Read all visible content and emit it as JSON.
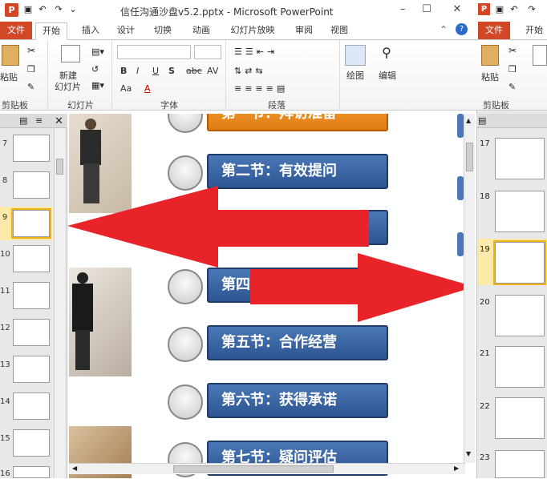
{
  "window": {
    "title": "信任沟通沙盘v5.2.pptx - Microsoft PowerPoint",
    "app_icon": "P"
  },
  "tabs": {
    "file": "文件",
    "items": [
      "开始",
      "插入",
      "设计",
      "切换",
      "动画",
      "幻灯片放映",
      "审阅",
      "视图"
    ]
  },
  "ribbon": {
    "clipboard": {
      "paste": "粘贴",
      "group": "剪贴板"
    },
    "slides": {
      "new_slide_1": "新建",
      "new_slide_2": "幻灯片",
      "group": "幻灯片"
    },
    "font": {
      "group": "字体",
      "buttons": [
        "B",
        "I",
        "U",
        "S",
        "abc",
        "AV",
        "Aa",
        "A"
      ]
    },
    "paragraph": {
      "group": "段落"
    },
    "drawing": {
      "label": "绘图"
    },
    "editing": {
      "label": "编辑"
    }
  },
  "thumbs_left": [
    "7",
    "8",
    "9",
    "10",
    "11",
    "12",
    "13",
    "14",
    "15",
    "16"
  ],
  "slide": {
    "sections": [
      "第一节：拜访准备",
      "第二节：有效提问",
      "",
      "第四",
      "第五节：合作经营",
      "第六节：获得承诺",
      "第七节：疑问评估"
    ]
  },
  "right_window": {
    "file": "文件",
    "home": "开始",
    "paste": "粘贴",
    "group": "剪贴板",
    "thumbs": [
      "17",
      "18",
      "19",
      "20",
      "21",
      "22",
      "23"
    ]
  },
  "colors": {
    "accent": "#d24726",
    "pill": "#3b68a6",
    "arrow": "#e8232a",
    "selected": "#f0b21b"
  }
}
